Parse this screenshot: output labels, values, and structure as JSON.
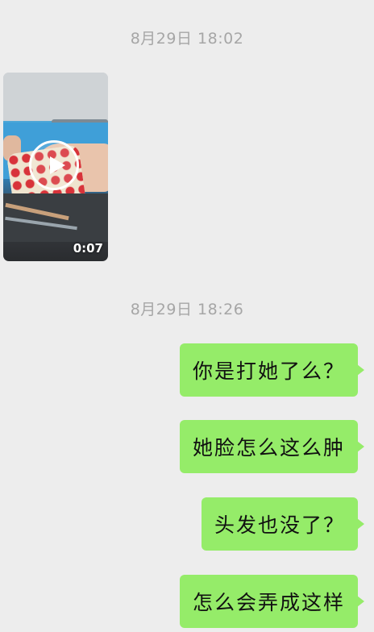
{
  "chat": {
    "timestamps": [
      "8月29日 18:02",
      "8月29日 18:26"
    ],
    "video_message": {
      "duration": "0:07",
      "icon": "play-icon"
    },
    "messages": [
      "你是打她了么？",
      "她脸怎么这么肿",
      "头发也没了？",
      "怎么会弄成这样"
    ],
    "colors": {
      "background": "#ededed",
      "sent_bubble": "#95ec69",
      "timestamp_text": "#a6a6a6"
    }
  }
}
